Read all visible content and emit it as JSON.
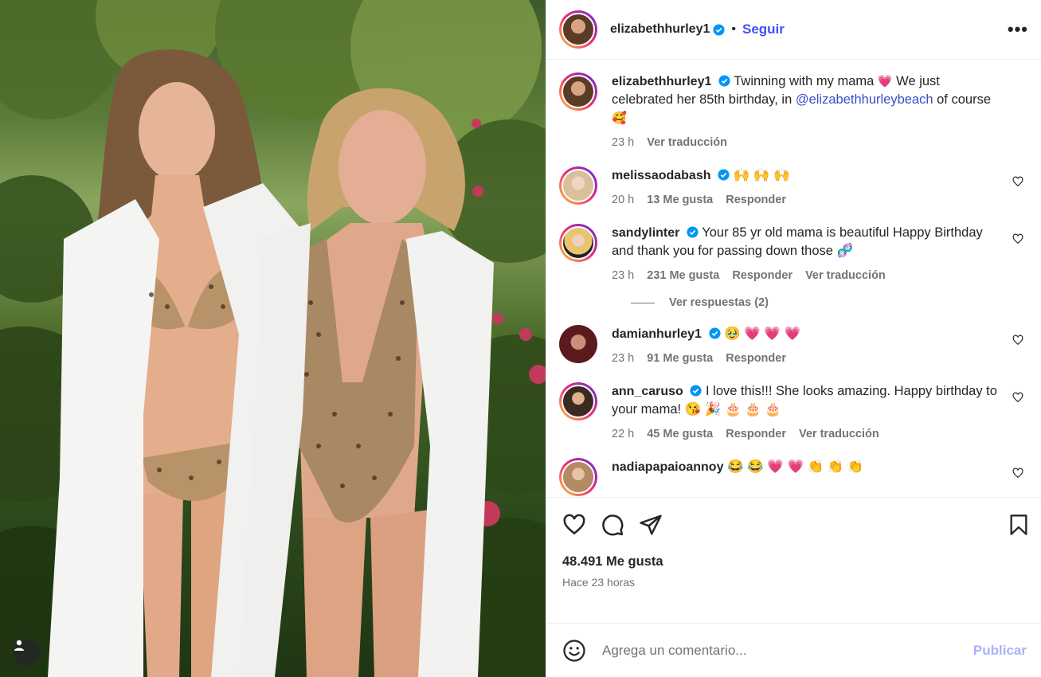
{
  "header": {
    "username": "elizabethhurley1",
    "separator": "•",
    "follow_label": "Seguir",
    "more_label": "•••"
  },
  "caption": {
    "username": "elizabethhurley1",
    "text_before": "Twinning with my mama ",
    "emoji1": "💗",
    "text_middle": " We just celebrated her 85th birthday, in ",
    "mention": "@elizabethhurleybeach",
    "text_after": " of course ",
    "emoji2": "🥰",
    "time": "23 h",
    "translate": "Ver traducción"
  },
  "comments": [
    {
      "username": "melissaodabash",
      "text": "🙌 🙌 🙌",
      "time": "20 h",
      "likes": "13 Me gusta",
      "reply": "Responder",
      "translate": ""
    },
    {
      "username": "sandylinter",
      "text": "Your 85 yr old mama is beautiful Happy Birthday and thank you for passing down those 🧬",
      "time": "23 h",
      "likes": "231 Me gusta",
      "reply": "Responder",
      "translate": "Ver traducción"
    },
    {
      "username": "damianhurley1",
      "text": "🥹 💗 💗 💗",
      "time": "23 h",
      "likes": "91 Me gusta",
      "reply": "Responder",
      "translate": ""
    },
    {
      "username": "ann_caruso",
      "text": "I love this!!! She looks amazing. Happy birthday to your mama! 😘 🎉 🎂 🎂 🎂",
      "time": "22 h",
      "likes": "45 Me gusta",
      "reply": "Responder",
      "translate": "Ver traducción"
    },
    {
      "username": "nadiapapaioannoy",
      "text": "😂 😂 💗 💗 👏 👏 👏",
      "time": "",
      "likes": "",
      "reply": "",
      "translate": ""
    }
  ],
  "view_replies": "Ver respuestas (2)",
  "actions": {
    "icons": [
      "heart-icon",
      "comment-icon",
      "share-icon",
      "bookmark-icon"
    ]
  },
  "likes_count": "48.491 Me gusta",
  "posted_ago": "Hace 23 horas",
  "add_comment": {
    "placeholder": "Agrega un comentario...",
    "publish_label": "Publicar"
  },
  "colors": {
    "link": "#4150f7",
    "mention": "#3a4fc7",
    "publish_disabled": "#a7b3f5",
    "secondary_text": "#737373"
  }
}
